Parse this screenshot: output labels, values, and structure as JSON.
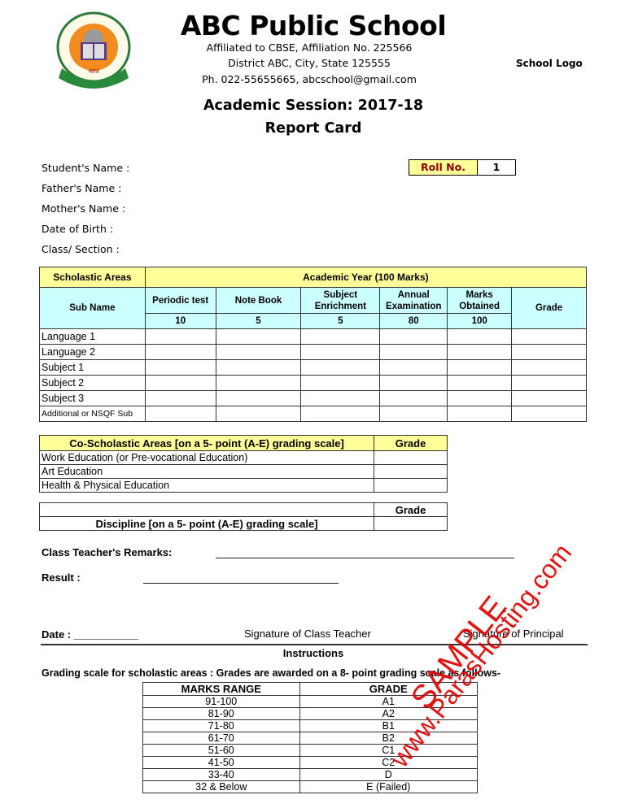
{
  "header": {
    "school_name": "ABC Public School",
    "affiliation": "Affiliated to CBSE, Affiliation No. 225566",
    "address": "District ABC, City, State  125555",
    "contact": "Ph. 022-55655665, abcschool@gmail.com",
    "school_logo_label": "School Logo",
    "emblem": "cbse-emblem-icon"
  },
  "titles": {
    "session": "Academic Session: 2017-18",
    "report_card": "Report Card"
  },
  "student": {
    "fields": [
      {
        "label": "Student's Name :",
        "value": ""
      },
      {
        "label": "Father's Name :",
        "value": ""
      },
      {
        "label": "Mother's Name :",
        "value": ""
      },
      {
        "label": "Date of Birth :",
        "value": ""
      },
      {
        "label": "Class/ Section :",
        "value": ""
      }
    ],
    "roll_label": "Roll No.",
    "roll_value": "1"
  },
  "scholastic": {
    "area_header": "Scholastic Areas",
    "year_header": "Academic Year (100 Marks)",
    "sub_name_header": "Sub Name",
    "grade_header": "Grade",
    "columns": [
      {
        "label": "Periodic test",
        "max": "10"
      },
      {
        "label": "Note Book",
        "max": "5"
      },
      {
        "label": "Subject Enrichment",
        "max": "5"
      },
      {
        "label": "Annual Examination",
        "max": "80"
      },
      {
        "label": "Marks Obtained",
        "max": "100"
      }
    ],
    "subjects": [
      "Language 1",
      "Language 2",
      "Subject 1",
      "Subject 2",
      "Subject 3",
      "Additional or NSQF Sub"
    ]
  },
  "co_scholastic": {
    "header": "Co-Scholastic Areas [on a 5- point (A-E) grading scale]",
    "grade_header": "Grade",
    "rows": [
      "Work Education (or Pre-vocational Education)",
      "Art Education",
      "Health & Physical Education"
    ]
  },
  "discipline": {
    "label": "Discipline [on a 5- point (A-E) grading scale]",
    "grade_header": "Grade"
  },
  "remarks": {
    "teacher_label": "Class Teacher's Remarks:",
    "result_label": "Result :",
    "date_label": "Date : ___________",
    "sig_teacher": "Signature of Class Teacher",
    "sig_principal": "Signature of Principal"
  },
  "instructions": {
    "title": "Instructions",
    "text": "Grading scale for scholastic areas : Grades are awarded on a 8- point grading scale as follows-",
    "headers": [
      "MARKS RANGE",
      "GRADE"
    ],
    "rows": [
      [
        "91-100",
        "A1"
      ],
      [
        "81-90",
        "A2"
      ],
      [
        "71-80",
        "B1"
      ],
      [
        "61-70",
        "B2"
      ],
      [
        "51-60",
        "C1"
      ],
      [
        "41-50",
        "C2"
      ],
      [
        "33-40",
        "D"
      ],
      [
        "32 & Below",
        "E (Failed)"
      ]
    ]
  },
  "watermark": {
    "line1": "SAMPLE",
    "line2": "www.ParasHosting.com",
    "color": "#e00000"
  },
  "colors": {
    "header_yellow": "#ffff99",
    "header_cyan": "#ccffff",
    "roll_text": "#8b0000"
  }
}
